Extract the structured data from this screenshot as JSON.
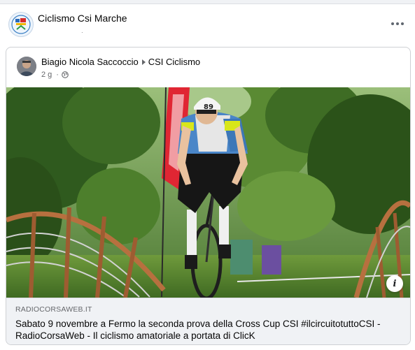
{
  "page": {
    "name": "Ciclismo Csi Marche",
    "subtitle": "·"
  },
  "shared_post": {
    "author": "Biagio Nicola Saccoccio",
    "group": "CSI Ciclismo",
    "time": "2 g",
    "separator": "·",
    "privacy_icon": "globe-icon",
    "photo": {
      "number_plate": "89",
      "banner_colors": [
        "#e02633",
        "#ffffff"
      ]
    },
    "link": {
      "domain": "RADIOCORSAWEB.IT",
      "title": "Sabato 9 novembre a Fermo la seconda prova della Cross Cup CSI #ilcircuitotuttoCSI - RadioCorsaWeb - Il ciclismo amatoriale a portata di ClicK"
    }
  },
  "icons": {
    "more": "more-options-icon",
    "info": "info-icon",
    "arrow": "shared-to-arrow-icon"
  }
}
